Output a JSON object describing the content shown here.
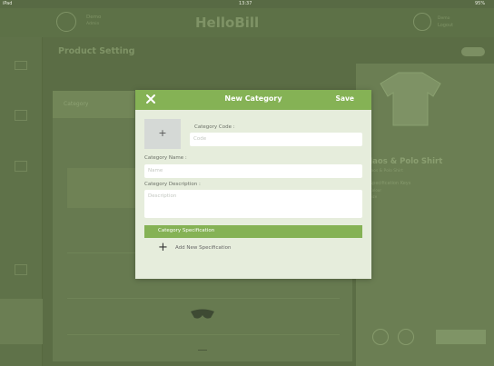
{
  "status_bar": {
    "carrier": "iPad",
    "time": "13:37",
    "battery": "95%"
  },
  "topbar": {
    "brand": "HelloBill",
    "left_name": "Demo",
    "left_sub": "Admin",
    "right_label": "Logout",
    "right_sub": "Demo"
  },
  "page": {
    "title": "Product Setting",
    "left_header": "Category"
  },
  "product": {
    "name": "Jaos & Polo Shirt",
    "sub": "Jaos & Polo Shirt",
    "specs_title": "Specification Keys",
    "spec_1": "Colour",
    "spec_2": "Size"
  },
  "modal": {
    "title": "New Category",
    "save_label": "Save",
    "add_image_glyph": "+",
    "code_label": "Category Code :",
    "code_placeholder": "Code",
    "name_label": "Category Name :",
    "name_placeholder": "Name",
    "desc_label": "Category Description :",
    "desc_placeholder": "Description",
    "spec_header": "Category Specification",
    "add_spec_glyph": "+",
    "add_spec_label": "Add New Specification"
  },
  "colors": {
    "accent": "#85b255",
    "modal_bg": "#e6eddc"
  },
  "icons": {
    "close": "close-icon",
    "plus": "plus-icon",
    "shirt": "shirt-icon",
    "sunglasses": "sunglasses-icon"
  }
}
